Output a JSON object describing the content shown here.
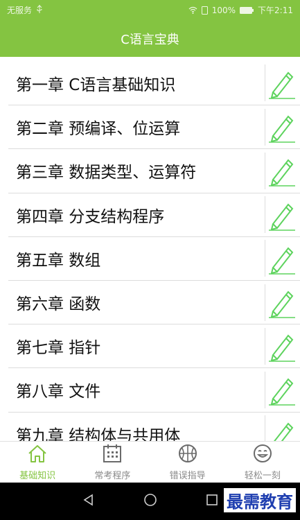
{
  "status_bar": {
    "carrier": "无服务",
    "battery": "100%",
    "time": "下午2:11"
  },
  "app": {
    "title": "C语言宝典"
  },
  "chapters": [
    {
      "label": "第一章 C语言基础知识"
    },
    {
      "label": "第二章 预编译、位运算"
    },
    {
      "label": "第三章 数据类型、运算符"
    },
    {
      "label": "第四章 分支结构程序"
    },
    {
      "label": "第五章 数组"
    },
    {
      "label": "第六章 函数"
    },
    {
      "label": "第七章 指针"
    },
    {
      "label": "第八章 文件"
    },
    {
      "label": "第九章 结构体与共用体"
    }
  ],
  "tabs": [
    {
      "label": "基础知识",
      "icon": "home-icon",
      "active": true
    },
    {
      "label": "常考程序",
      "icon": "calendar-icon",
      "active": false
    },
    {
      "label": "错误指导",
      "icon": "basketball-icon",
      "active": false
    },
    {
      "label": "轻松一刻",
      "icon": "smiley-icon",
      "active": false
    }
  ],
  "watermark": {
    "text": "最需教育"
  },
  "colors": {
    "accent": "#84c441",
    "pencil": "#5dd35d",
    "tab_inactive": "#8a8a8a"
  }
}
